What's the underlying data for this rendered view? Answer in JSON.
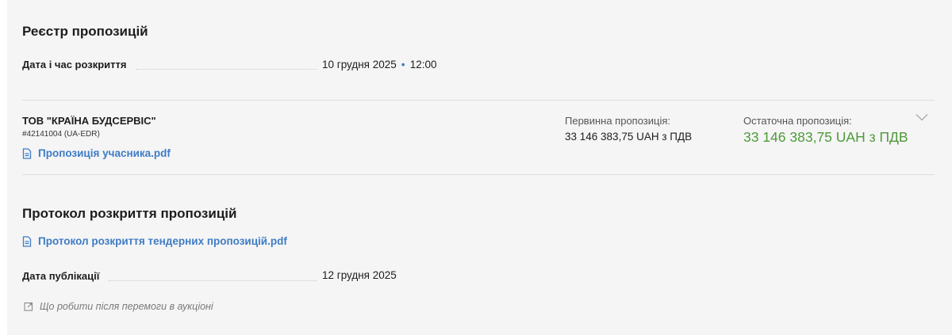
{
  "registry": {
    "title": "Реєстр пропозицій",
    "opening_label": "Дата і час розкриття",
    "opening_date": "10 грудня 2025",
    "opening_time": "12:00"
  },
  "bidder": {
    "name": "ТОВ \"КРАЇНА БУДСЕРВІС\"",
    "id": "#42141004 (UA-EDR)",
    "file_link": "Пропозиція учасника.pdf",
    "initial_label": "Первинна пропозиція:",
    "initial_value": "33 146 383,75 UAH з ПДВ",
    "final_label": "Остаточна пропозиція:",
    "final_value": "33 146 383,75 UAH з ПДВ",
    "final_color": "#4d9a3a"
  },
  "protocol": {
    "title": "Протокол розкриття пропозицій",
    "file_link": "Протокол розкриття тендерних пропозицій.pdf",
    "published_label": "Дата публікації",
    "published_date": "12 грудня 2025"
  },
  "help_link": "Що робити після перемоги в аукціоні",
  "icons": {
    "file": "file-icon",
    "expand": "chevron-down-icon",
    "external": "external-link-icon"
  },
  "accent_color": "#3f7cc5"
}
